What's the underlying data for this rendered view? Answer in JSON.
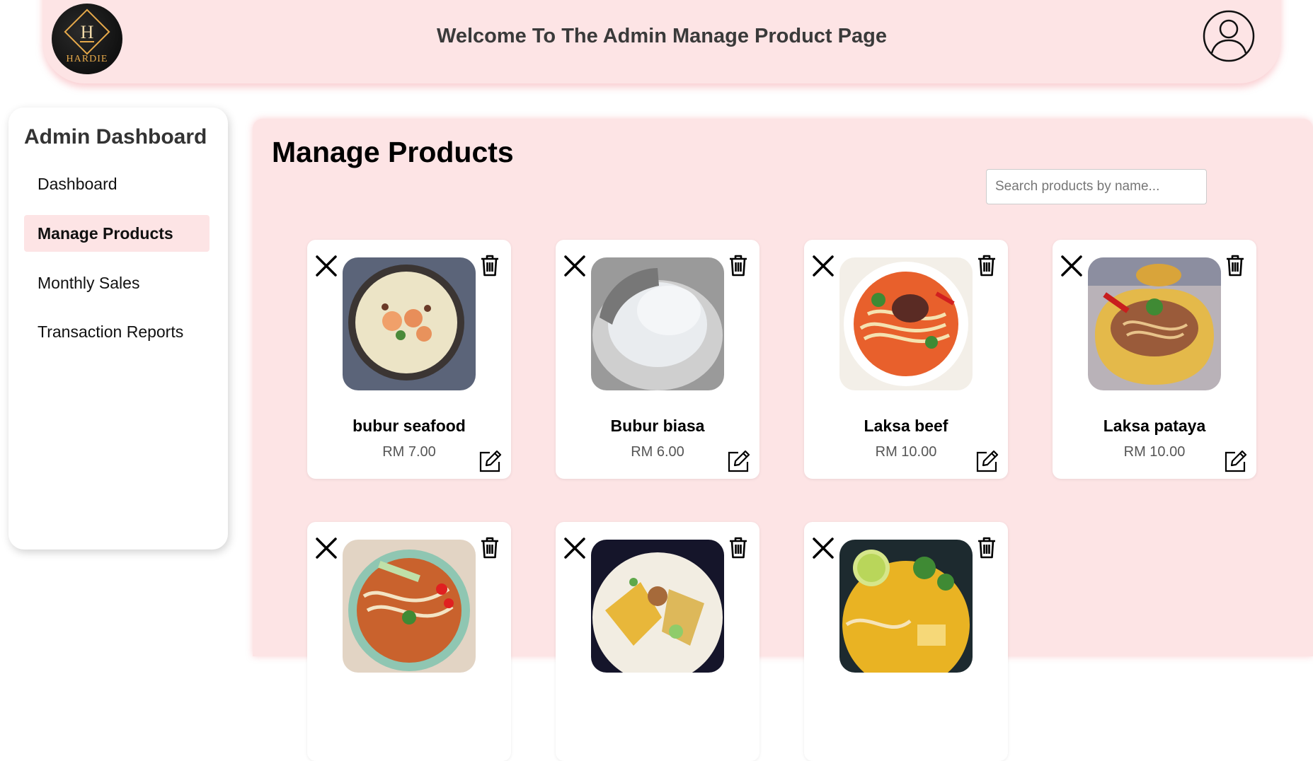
{
  "header": {
    "logo_text": "HARDIE",
    "logo_letter": "H",
    "title": "Welcome To The Admin Manage Product Page",
    "profile_icon": "user-profile-icon"
  },
  "sidebar": {
    "title": "Admin Dashboard",
    "items": [
      {
        "label": "Dashboard",
        "active": false
      },
      {
        "label": "Manage Products",
        "active": true
      },
      {
        "label": "Monthly Sales",
        "active": false
      },
      {
        "label": "Transaction Reports",
        "active": false
      }
    ]
  },
  "main": {
    "title": "Manage Products",
    "search": {
      "value": "",
      "placeholder": "Search products by name..."
    }
  },
  "products": [
    {
      "name": "bubur seafood",
      "price": "RM 7.00"
    },
    {
      "name": "Bubur biasa",
      "price": "RM 6.00"
    },
    {
      "name": "Laksa beef",
      "price": "RM 10.00"
    },
    {
      "name": "Laksa pataya",
      "price": "RM 10.00"
    },
    {
      "name": "",
      "price": ""
    },
    {
      "name": "",
      "price": ""
    },
    {
      "name": "",
      "price": ""
    }
  ],
  "colors": {
    "accent_pink": "#fde4e5",
    "logo_gold": "#e6a94a"
  }
}
